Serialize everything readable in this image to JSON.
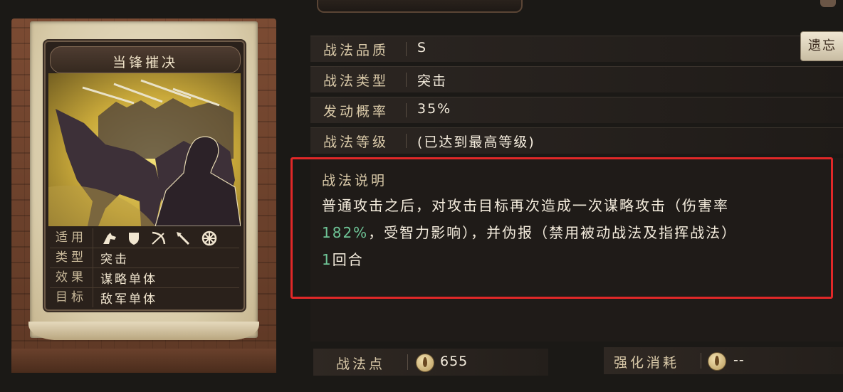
{
  "card": {
    "title": "当锋摧决",
    "rows": [
      {
        "label": "适用",
        "value": ""
      },
      {
        "label": "类型",
        "value": "突击"
      },
      {
        "label": "效果",
        "value": "谋略单体"
      },
      {
        "label": "目标",
        "value": "敌军单体"
      }
    ],
    "applicable_icons": [
      "cavalry-icon",
      "shield-icon",
      "bow-icon",
      "spear-icon",
      "wheel-icon"
    ]
  },
  "info": {
    "quality_label": "战法品质",
    "quality_value": "S",
    "type_label": "战法类型",
    "type_value": "突击",
    "rate_label": "发动概率",
    "rate_value": "35%",
    "level_label": "战法等级",
    "level_value": "(已达到最高等级)",
    "forget_button": "遗忘"
  },
  "description": {
    "title": "战法说明",
    "line1": "普通攻击之后，对攻击目标再次造成一次谋略攻击（伤害率",
    "rate": "182%",
    "line2": "，受智力影响），并伪报（禁用被动战法及指挥战法）",
    "rounds": "1",
    "rounds_suffix": "回合"
  },
  "footer": {
    "points_label": "战法点",
    "points_value": "655",
    "cost_label": "强化消耗",
    "cost_value": "--"
  },
  "colors": {
    "highlight": "#6ec496",
    "frame": "#e02828"
  }
}
